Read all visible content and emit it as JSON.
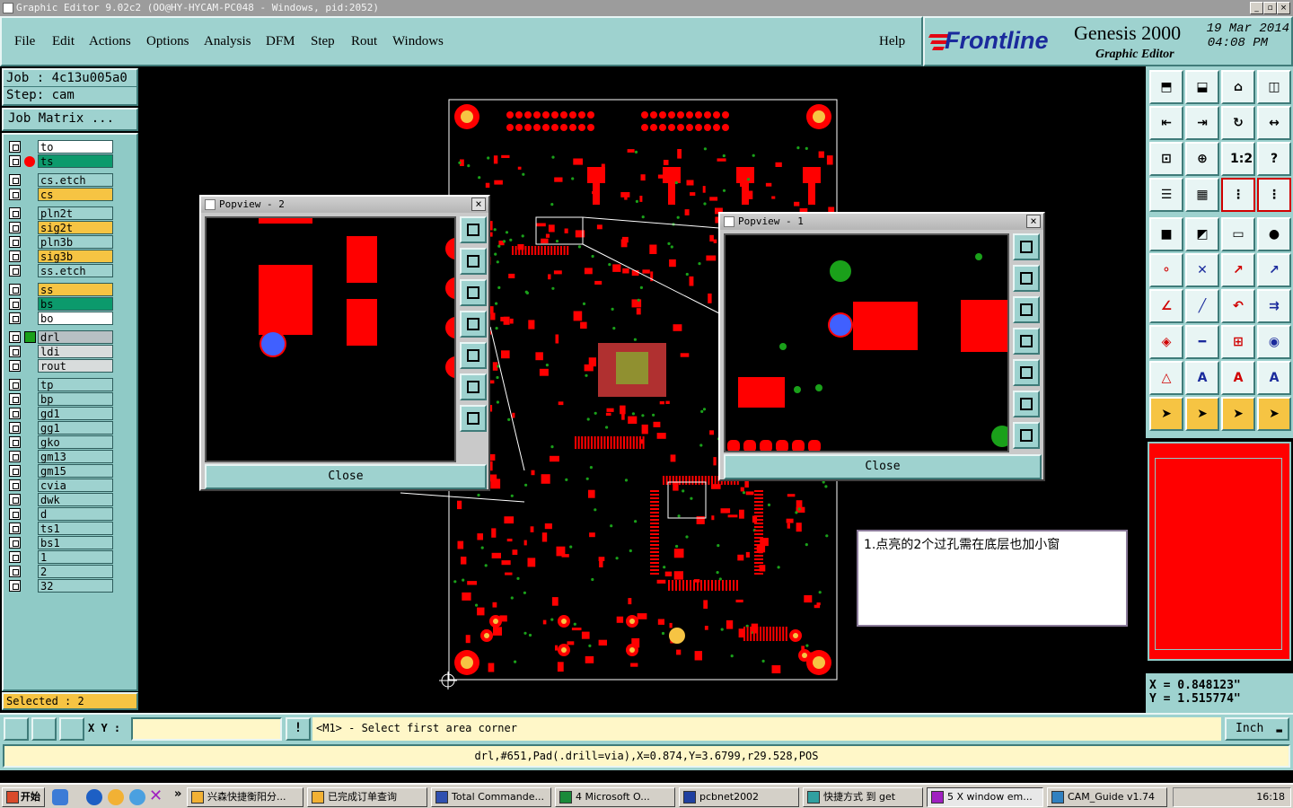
{
  "window": {
    "title": "Graphic Editor 9.02c2 (OO@HY-HYCAM-PC048 - Windows, pid:2052)",
    "btn_min": "_",
    "btn_max": "▫",
    "btn_close": "×"
  },
  "menu": {
    "items": [
      "File",
      "Edit",
      "Actions",
      "Options",
      "Analysis",
      "DFM",
      "Step",
      "Rout",
      "Windows"
    ],
    "help": "Help"
  },
  "brand": {
    "logo": "Frontline",
    "product": "Genesis 2000",
    "subtitle": "Graphic Editor",
    "date": "19 Mar 2014",
    "time": "04:08 PM"
  },
  "job": {
    "job_line": "Job : 4c13u005a0",
    "step_line": "Step: cam",
    "matrix_button": "Job Matrix ..."
  },
  "layers": [
    {
      "name": "to",
      "color": "#ffffff"
    },
    {
      "name": "ts",
      "color": "#0c9a6c"
    },
    {
      "name": "cs.etch",
      "color": "#9ed2cf"
    },
    {
      "name": "cs",
      "color": "#f6c443"
    },
    {
      "name": "pln2t",
      "color": "#9ed2cf"
    },
    {
      "name": "sig2t",
      "color": "#f6c443"
    },
    {
      "name": "pln3b",
      "color": "#9ed2cf"
    },
    {
      "name": "sig3b",
      "color": "#f6c443"
    },
    {
      "name": "ss.etch",
      "color": "#9ed2cf"
    },
    {
      "name": "ss",
      "color": "#f6c443"
    },
    {
      "name": "bs",
      "color": "#0c9a6c"
    },
    {
      "name": "bo",
      "color": "#ffffff"
    },
    {
      "name": "drl",
      "color": "#b8c0c4"
    },
    {
      "name": "ldi",
      "color": "#d8dcdc"
    },
    {
      "name": "rout",
      "color": "#d8dcdc"
    },
    {
      "name": "tp",
      "color": "#9ed2cf"
    },
    {
      "name": "bp",
      "color": "#9ed2cf"
    },
    {
      "name": "gd1",
      "color": "#9ed2cf"
    },
    {
      "name": "gg1",
      "color": "#9ed2cf"
    },
    {
      "name": "gko",
      "color": "#9ed2cf"
    },
    {
      "name": "gm13",
      "color": "#9ed2cf"
    },
    {
      "name": "gm15",
      "color": "#9ed2cf"
    },
    {
      "name": "cvia",
      "color": "#9ed2cf"
    },
    {
      "name": "dwk",
      "color": "#9ed2cf"
    },
    {
      "name": "d",
      "color": "#9ed2cf"
    },
    {
      "name": "ts1",
      "color": "#9ed2cf"
    },
    {
      "name": "bs1",
      "color": "#9ed2cf"
    },
    {
      "name": "1",
      "color": "#9ed2cf"
    },
    {
      "name": "2",
      "color": "#9ed2cf"
    },
    {
      "name": "32",
      "color": "#9ed2cf"
    }
  ],
  "selected": "Selected : 2",
  "popview2": {
    "title": "Popview - 2",
    "close": "Close",
    "close_x": "×"
  },
  "popview1": {
    "title": "Popview - 1",
    "close": "Close",
    "close_x": "×"
  },
  "annotation": "1.点亮的2个过孔需在底层也加小窗",
  "coords": {
    "x": "X = 0.848123\"",
    "y": "Y = 1.515774\""
  },
  "toolbox": {
    "ratio_label": "1:2",
    "help_label": "?"
  },
  "cmd": {
    "xy_label": "X Y :",
    "xy_value": "",
    "bang": "!",
    "prompt": "<M1> - Select first area corner",
    "unit": "Inch"
  },
  "status": "drl,#651,Pad(.drill=via),X=0.874,Y=3.6799,r29.528,POS",
  "taskbar": {
    "start": "开始",
    "chevron": "»",
    "tasks": [
      "兴森快捷衡阳分...",
      "已完成订单查询",
      "Total Commande...",
      "4 Microsoft O...",
      "pcbnet2002",
      "快捷方式 到 get",
      "5 X window em...",
      "CAM_Guide v1.74"
    ],
    "clock": "16:18"
  }
}
